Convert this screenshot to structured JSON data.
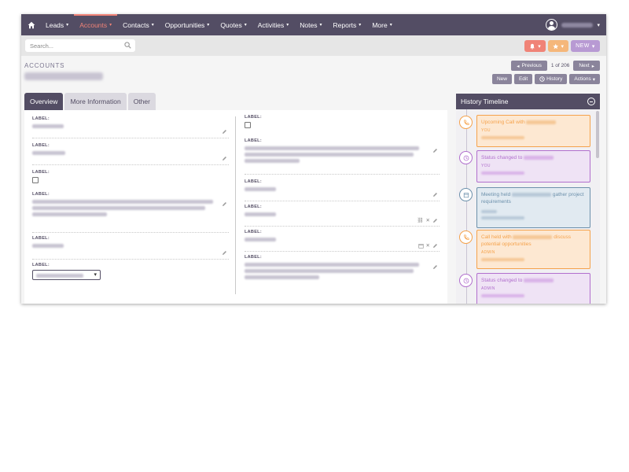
{
  "nav": {
    "items": [
      {
        "label": "Leads",
        "active": false
      },
      {
        "label": "Accounts",
        "active": true
      },
      {
        "label": "Contacts",
        "active": false
      },
      {
        "label": "Opportunities",
        "active": false
      },
      {
        "label": "Quotes",
        "active": false
      },
      {
        "label": "Activities",
        "active": false
      },
      {
        "label": "Notes",
        "active": false
      },
      {
        "label": "Reports",
        "active": false
      },
      {
        "label": "More",
        "active": false
      }
    ],
    "caret": "▾",
    "user_caret": "▾",
    "icons": {
      "home": "home-icon",
      "user": "user-avatar-icon"
    }
  },
  "search": {
    "placeholder": "Search...",
    "new_label": "NEW",
    "caret": "▾",
    "icons": {
      "search": "search-icon",
      "bell": "bell-icon",
      "star": "star-icon"
    }
  },
  "header": {
    "module": "ACCOUNTS",
    "pager": {
      "previous": "Previous",
      "next": "Next",
      "count": "1 of 206"
    },
    "actions": {
      "new": "New",
      "edit": "Edit",
      "history": "History",
      "actions": "Actions"
    }
  },
  "tabs": [
    {
      "label": "Overview",
      "active": true
    },
    {
      "label": "More Information",
      "active": false
    },
    {
      "label": "Other",
      "active": false
    }
  ],
  "fields": {
    "label": "LABEL:",
    "select_caret": "▾"
  },
  "timeline": {
    "title": "History Timeline",
    "items": [
      {
        "kind": "call",
        "title": "Upcoming Call with",
        "extra": "",
        "user": "YOU",
        "color": "#f5a24b"
      },
      {
        "kind": "status",
        "title": "Status changed to",
        "extra": "",
        "user": "YOU",
        "color": "#b16fcd"
      },
      {
        "kind": "meeting",
        "title": "Meeting held",
        "extra": "gather project requirements",
        "user": "",
        "color": "#6c90ab"
      },
      {
        "kind": "call",
        "title": "Call held with",
        "extra": "discuss potential opportunities",
        "user": "ADMIN",
        "color": "#f5a24b"
      },
      {
        "kind": "status",
        "title": "Status changed to",
        "extra": "",
        "user": "ADMIN",
        "color": "#b16fcd"
      }
    ]
  },
  "colors": {
    "nav_bg": "#534d64",
    "accent": "#f08377",
    "bell": "#f08377",
    "star": "#f5b77a",
    "new": "#b89ad3",
    "timeline_orange": "#f5a24b",
    "timeline_purple": "#b16fcd",
    "timeline_teal": "#6c90ab"
  }
}
